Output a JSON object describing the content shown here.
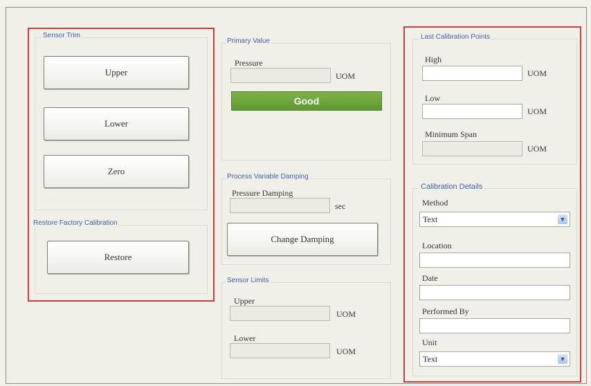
{
  "sensor_trim": {
    "title": "Sensor Trim",
    "upper_label": "Upper",
    "lower_label": "Lower",
    "zero_label": "Zero"
  },
  "restore_factory": {
    "title": "Restore Factory Calibration",
    "restore_label": "Restore"
  },
  "primary_value": {
    "title": "Primary Value",
    "pressure_label": "Pressure",
    "pressure_value": "",
    "uom": "UOM",
    "status": "Good",
    "status_color": "#6aa53a"
  },
  "damping": {
    "title": "Process Variable Damping",
    "pressure_damping_label": "Pressure Damping",
    "pressure_damping_value": "",
    "unit": "sec",
    "change_label": "Change Damping"
  },
  "sensor_limits": {
    "title": "Sensor Limits",
    "upper_label": "Upper",
    "upper_value": "",
    "lower_label": "Lower",
    "lower_value": "",
    "uom": "UOM"
  },
  "last_calibration": {
    "title": "Last Calibration Points",
    "high_label": "High",
    "high_value": "",
    "low_label": "Low",
    "low_value": "",
    "min_span_label": "Minimum Span",
    "min_span_value": "",
    "uom": "UOM"
  },
  "calibration_details": {
    "title": "Calibration Details",
    "method_label": "Method",
    "method_value": "Text",
    "location_label": "Location",
    "location_value": "",
    "date_label": "Date",
    "date_value": "",
    "performed_by_label": "Performed By",
    "performed_by_value": "",
    "unit_label": "Unit",
    "unit_value": "Text"
  },
  "colors": {
    "highlight": "#d43a3a",
    "group_title": "#3d62b0"
  }
}
